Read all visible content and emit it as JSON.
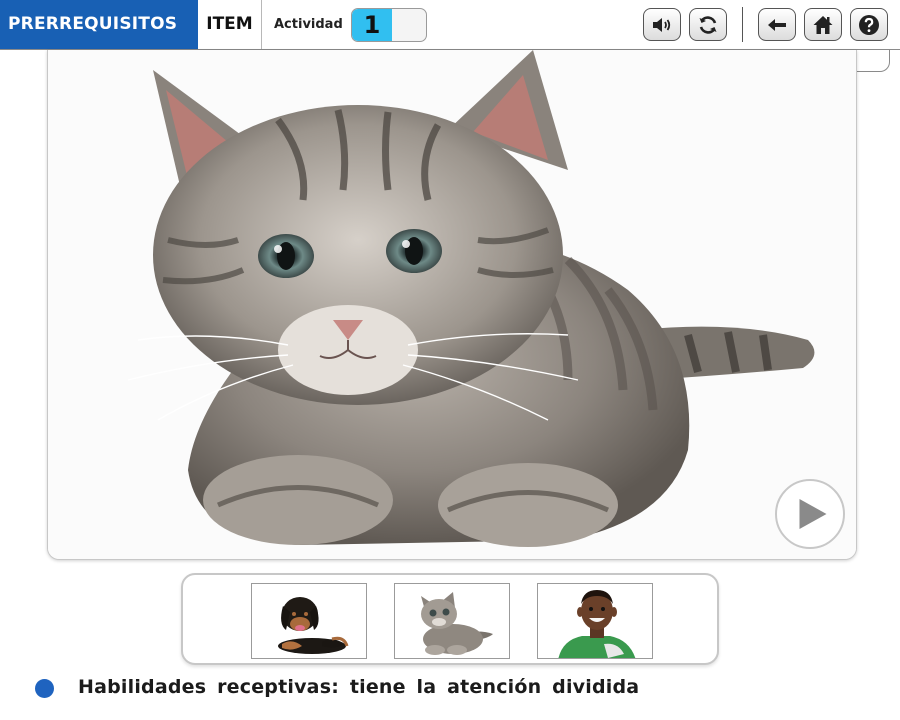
{
  "header": {
    "section_title": "PRERREQUISITOS",
    "item_label": "ITEM",
    "activity_label": "Actividad",
    "activity_number": "1"
  },
  "toolbar": {
    "buttons": [
      "speaker-icon",
      "refresh-icon",
      "back-arrow-icon",
      "home-icon",
      "help-icon"
    ]
  },
  "main": {
    "image": "kitten-photo",
    "play_icon": "play-icon"
  },
  "options": [
    {
      "image": "puppy-photo"
    },
    {
      "image": "kitten-photo"
    },
    {
      "image": "boy-photo"
    }
  ],
  "footer": {
    "text": "Habilidades receptivas: tiene la atención dividida"
  },
  "colors": {
    "brand_blue": "#1860b4",
    "counter_cyan": "#31bff0",
    "bullet_blue": "#1f63bf"
  }
}
